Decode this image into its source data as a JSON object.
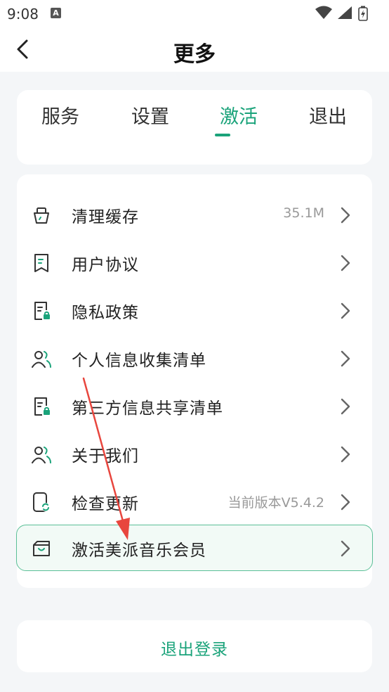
{
  "status_bar": {
    "time": "9:08",
    "notification_badge": "A"
  },
  "header": {
    "title": "更多"
  },
  "tabs": [
    {
      "label": "服务",
      "active": false
    },
    {
      "label": "设置",
      "active": false
    },
    {
      "label": "激活",
      "active": true
    },
    {
      "label": "退出",
      "active": false
    }
  ],
  "menu": [
    {
      "label": "清理缓存",
      "value": "35.1M",
      "icon": "clear-cache-icon"
    },
    {
      "label": "用户协议",
      "value": "",
      "icon": "agreement-icon"
    },
    {
      "label": "隐私政策",
      "value": "",
      "icon": "privacy-policy-icon"
    },
    {
      "label": "个人信息收集清单",
      "value": "",
      "icon": "personal-info-icon"
    },
    {
      "label": "第三方信息共享清单",
      "value": "",
      "icon": "third-party-share-icon"
    },
    {
      "label": "关于我们",
      "value": "",
      "icon": "about-us-icon"
    },
    {
      "label": "检查更新",
      "value": "当前版本V5.4.2",
      "icon": "check-update-icon"
    },
    {
      "label": "激活美派音乐会员",
      "value": "",
      "icon": "activate-membership-icon",
      "highlighted": true
    }
  ],
  "logout": {
    "label": "退出登录"
  },
  "colors": {
    "accent": "#1aa37a",
    "highlight_border": "#5bbf97",
    "arrow": "#e8463e"
  }
}
